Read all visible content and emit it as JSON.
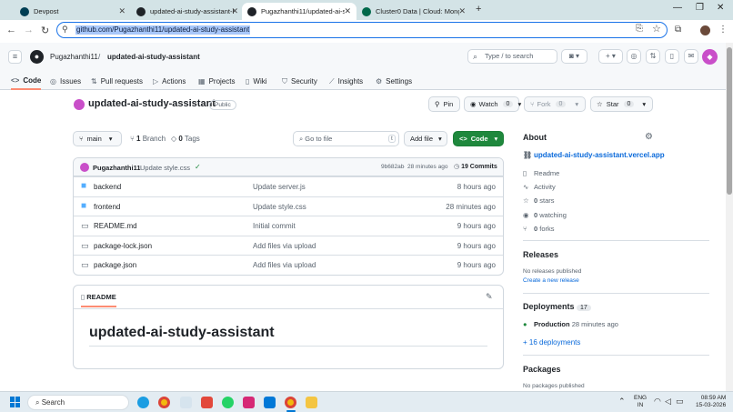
{
  "browser": {
    "tabs": [
      {
        "title": "Devpost",
        "color": "#003e54",
        "active": false
      },
      {
        "title": "updated-ai-study-assistant-ba",
        "color": "#1f2328",
        "active": false
      },
      {
        "title": "Pugazhanthi11/updated-ai-stud",
        "color": "#1f2328",
        "active": true
      },
      {
        "title": "Cluster0 Data | Cloud: MongoD",
        "color": "#00684a",
        "active": false
      }
    ],
    "new_tab": "+",
    "url": "github.com/Pugazhanthi11/updated-ai-study-assistant"
  },
  "header": {
    "owner": "Pugazhanthi11",
    "sep": "/",
    "repo": "updated-ai-study-assistant",
    "search_placeholder": "Type / to search"
  },
  "repo_nav": [
    {
      "label": "Code",
      "icon": "<>"
    },
    {
      "label": "Issues",
      "icon": "◎"
    },
    {
      "label": "Pull requests",
      "icon": "⇅"
    },
    {
      "label": "Actions",
      "icon": "▷"
    },
    {
      "label": "Projects",
      "icon": "▦"
    },
    {
      "label": "Wiki",
      "icon": "▯"
    },
    {
      "label": "Security",
      "icon": "⛉"
    },
    {
      "label": "Insights",
      "icon": "⟋"
    },
    {
      "label": "Settings",
      "icon": "⚙"
    }
  ],
  "repo": {
    "name": "updated-ai-study-assistant",
    "visibility": "Public",
    "pin": "Pin",
    "watch": "Watch",
    "watch_count": "0",
    "fork": "Fork",
    "fork_count": "0",
    "star": "Star",
    "star_count": "0"
  },
  "toolbar": {
    "branch": "main",
    "branch_count": "1",
    "branch_label": "Branch",
    "tag_count": "0",
    "tag_label": "Tags",
    "goto_placeholder": "Go to file",
    "goto_key": "t",
    "add_file": "Add file",
    "code": "Code"
  },
  "commit": {
    "author": "Pugazhanthi11",
    "message": "Update style.css",
    "status": "✓",
    "hash": "9b682ab",
    "dot": "·",
    "time": "28 minutes ago",
    "count": "19 Commits"
  },
  "files": [
    {
      "name": "backend",
      "type": "dir",
      "message": "Update server.js",
      "time": "8 hours ago"
    },
    {
      "name": "frontend",
      "type": "dir",
      "message": "Update style.css",
      "time": "28 minutes ago"
    },
    {
      "name": "README.md",
      "type": "file",
      "message": "Initial commit",
      "time": "9 hours ago"
    },
    {
      "name": "package-lock.json",
      "type": "file",
      "message": "Add files via upload",
      "time": "9 hours ago"
    },
    {
      "name": "package.json",
      "type": "file",
      "message": "Add files via upload",
      "time": "9 hours ago"
    }
  ],
  "readme": {
    "tab": "README",
    "heading": "updated-ai-study-assistant"
  },
  "about": {
    "title": "About",
    "link": "updated-ai-study-assistant.vercel.app",
    "readme": "Readme",
    "activity": "Activity",
    "stars_count": "0",
    "stars": "stars",
    "watching_count": "0",
    "watching": "watching",
    "forks_count": "0",
    "forks": "forks"
  },
  "releases": {
    "title": "Releases",
    "none": "No releases published",
    "create": "Create a new release"
  },
  "deployments": {
    "title": "Deployments",
    "count": "17",
    "env": "Production",
    "time": "28 minutes ago",
    "more": "+ 16 deployments"
  },
  "packages": {
    "title": "Packages",
    "none": "No packages published"
  },
  "taskbar": {
    "search": "Search",
    "lang1": "ENG",
    "lang2": "IN",
    "time": "08:59 AM",
    "date": "15-03-2026"
  },
  "colors": {
    "green": "#1f883d",
    "link": "#0969da",
    "accent": "#fd8c73"
  }
}
